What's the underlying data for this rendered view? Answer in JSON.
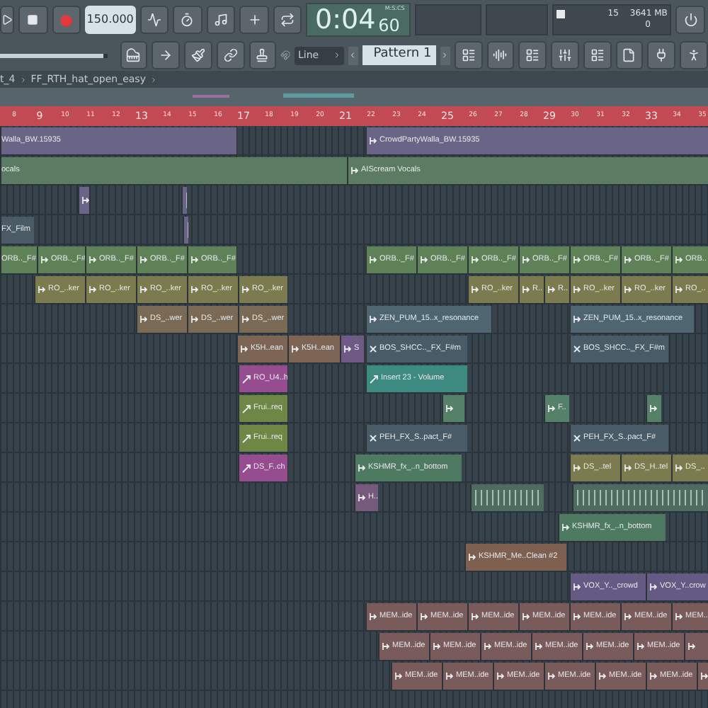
{
  "transport": {
    "tempo": "150.000",
    "time": "0:04",
    "time_cs": "60",
    "time_unit": "M:S:CS",
    "cpu": "15",
    "memory": "3641 MB",
    "polyphony": "0",
    "snap": "Line",
    "pattern": "Pattern 1",
    "volume": {
      "level": 0.97
    }
  },
  "breadcrumb": [
    "t_4",
    "FF_RTH_hat_open_easy"
  ],
  "ruler": [
    "8",
    "9",
    "10",
    "11",
    "12",
    "13",
    "14",
    "15",
    "16",
    "17",
    "18",
    "19",
    "20",
    "21",
    "22",
    "23",
    "24",
    "25",
    "26",
    "27",
    "28",
    "29",
    "30",
    "31",
    "32",
    "33",
    "34",
    "35"
  ],
  "tracks": [
    {
      "clips": [
        {
          "kind": "audio",
          "label": "Walla_BW.15935",
          "color": "#6a6486"
        },
        {
          "kind": "audio",
          "label": "CrowdPartyWalla_BW.15935",
          "color": "#6a6486"
        }
      ]
    },
    {
      "clips": [
        {
          "kind": "audio",
          "label": "ocals",
          "color": "#5b7c63"
        },
        {
          "kind": "audio",
          "label": "AIScream Vocals",
          "color": "#5b7c63"
        }
      ]
    },
    {
      "clips": [
        {
          "kind": "audio",
          "color": "#6a6486"
        },
        {
          "kind": "wave",
          "color": "#6a6486"
        }
      ]
    },
    {
      "clips": [
        {
          "kind": "audio",
          "label": "FX_Film",
          "color": "#4a5b66"
        },
        {
          "kind": "wave",
          "color": "#6a6486"
        }
      ]
    },
    {
      "clips": [
        {
          "kind": "audio",
          "label": "ORB.._F#",
          "color": "#5e8158"
        },
        {
          "kind": "audio",
          "label": "ORB.._F#",
          "color": "#5e8158"
        },
        {
          "kind": "audio",
          "label": "ORB.._F#",
          "color": "#5e8158"
        },
        {
          "kind": "audio",
          "label": "ORB.._F#",
          "color": "#5e8158"
        },
        {
          "kind": "audio",
          "label": "ORB.._F#",
          "color": "#5e8158"
        },
        {
          "kind": "audio",
          "label": "ORB.._F#",
          "color": "#5e8158"
        },
        {
          "kind": "audio",
          "label": "ORB.._F#",
          "color": "#5e8158"
        },
        {
          "kind": "audio",
          "label": "ORB.._F#",
          "color": "#5e8158"
        },
        {
          "kind": "audio",
          "label": "ORB.._F#",
          "color": "#5e8158"
        },
        {
          "kind": "audio",
          "label": "ORB.._F#",
          "color": "#5e8158"
        },
        {
          "kind": "audio",
          "label": "ORB.._F#",
          "color": "#5e8158"
        },
        {
          "kind": "audio",
          "label": "ORB..",
          "color": "#5e8158"
        }
      ]
    },
    {
      "clips": [
        {
          "kind": "audio",
          "label": "RO_..ker",
          "color": "#7c7b4f"
        },
        {
          "kind": "audio",
          "label": "RO_..ker",
          "color": "#7c7b4f"
        },
        {
          "kind": "audio",
          "label": "RO_..ker",
          "color": "#7c7b4f"
        },
        {
          "kind": "audio",
          "label": "RO_..ker",
          "color": "#7c7b4f"
        },
        {
          "kind": "audio",
          "label": "RO_..ker",
          "color": "#7c7b4f"
        },
        {
          "kind": "audio",
          "label": "RO_..ker",
          "color": "#7c7b4f"
        },
        {
          "kind": "audio",
          "label": "R..",
          "color": "#7c7b4f"
        },
        {
          "kind": "audio",
          "label": "R..",
          "color": "#7c7b4f"
        },
        {
          "kind": "audio",
          "label": "RO_..ker",
          "color": "#7c7b4f"
        },
        {
          "kind": "audio",
          "label": "RO_..ker",
          "color": "#7c7b4f"
        },
        {
          "kind": "audio",
          "label": "RO_..",
          "color": "#7c7b4f"
        }
      ]
    },
    {
      "clips": [
        {
          "kind": "audio",
          "label": "DS_..wer",
          "color": "#7a6954"
        },
        {
          "kind": "audio",
          "label": "DS_..wer",
          "color": "#7a6954"
        },
        {
          "kind": "audio",
          "label": "DS_..wer",
          "color": "#7a6954"
        },
        {
          "kind": "audio",
          "label": "ZEN_PUM_15..x_resonance",
          "color": "#4f6670"
        },
        {
          "kind": "audio",
          "label": "ZEN_PUM_15..x_resonance",
          "color": "#4f6670"
        }
      ]
    },
    {
      "clips": [
        {
          "kind": "audio",
          "label": "K5H..ean",
          "color": "#7d6556"
        },
        {
          "kind": "audio",
          "label": "K5H..ean",
          "color": "#7d6556"
        },
        {
          "kind": "audio",
          "label": "S",
          "color": "#6f5a85"
        },
        {
          "kind": "pattern",
          "label": "BOS_SHCC.._FX_F#m",
          "color": "#485b66"
        },
        {
          "kind": "pattern",
          "label": "BOS_SHCC.._FX_F#m",
          "color": "#485b66"
        }
      ]
    },
    {
      "clips": [
        {
          "kind": "automation",
          "label": "RO_U4..h",
          "color": "#954d8f"
        },
        {
          "kind": "automation",
          "label": "Insert 23 - Volume",
          "color": "#3d8a80"
        }
      ]
    },
    {
      "clips": [
        {
          "kind": "automation",
          "label": "Frui..req",
          "color": "#6e8646"
        },
        {
          "kind": "audio",
          "color": "#55806a"
        },
        {
          "kind": "audio",
          "label": "F..",
          "color": "#55806a"
        },
        {
          "kind": "audio",
          "color": "#55806a"
        }
      ]
    },
    {
      "clips": [
        {
          "kind": "automation",
          "label": "Frui..req",
          "color": "#6e8646"
        },
        {
          "kind": "pattern",
          "label": "PEH_FX_S..pact_F#",
          "color": "#485b66"
        },
        {
          "kind": "pattern",
          "label": "PEH_FX_S..pact_F#",
          "color": "#485b66"
        }
      ]
    },
    {
      "clips": [
        {
          "kind": "automation",
          "label": "DS_F..ch",
          "color": "#954d8f"
        },
        {
          "kind": "audio",
          "label": "KSHMR_fx_..n_bottom",
          "color": "#4f7a62"
        },
        {
          "kind": "audio",
          "label": "DS_..tel",
          "color": "#7c7b4f"
        },
        {
          "kind": "audio",
          "label": "DS_H..tel",
          "color": "#7c7b4f"
        },
        {
          "kind": "audio",
          "label": "DS_..",
          "color": "#7c7b4f"
        }
      ]
    },
    {
      "clips": [
        {
          "kind": "audio",
          "label": "H..",
          "color": "#765a7c"
        },
        {
          "kind": "wave",
          "color": "#4f6a60"
        },
        {
          "kind": "wave",
          "color": "#4f6a60"
        }
      ]
    },
    {
      "clips": [
        {
          "kind": "audio",
          "label": "KSHMR_fx_..n_bottom",
          "color": "#4f7a62"
        }
      ]
    },
    {
      "clips": [
        {
          "kind": "audio",
          "label": "KSHMR_Me..Clean #2",
          "color": "#7d6050"
        }
      ]
    },
    {
      "clips": [
        {
          "kind": "audio",
          "label": "VOX_Y.._crowd",
          "color": "#645a84"
        },
        {
          "kind": "audio",
          "label": "VOX_Y..crow",
          "color": "#645a84"
        }
      ]
    },
    {
      "clips": [
        {
          "kind": "audio",
          "label": "MEM..ide",
          "color": "#795b5b"
        },
        {
          "kind": "audio",
          "label": "MEM..ide",
          "color": "#795b5b"
        },
        {
          "kind": "audio",
          "label": "MEM..ide",
          "color": "#795b5b"
        },
        {
          "kind": "audio",
          "label": "MEM..ide",
          "color": "#795b5b"
        },
        {
          "kind": "audio",
          "label": "MEM..ide",
          "color": "#795b5b"
        },
        {
          "kind": "audio",
          "label": "MEM..ide",
          "color": "#795b5b"
        },
        {
          "kind": "audio",
          "label": "MEM..",
          "color": "#795b5b"
        }
      ]
    },
    {
      "clips": [
        {
          "kind": "audio",
          "label": "MEM..ide",
          "color": "#795b5b"
        },
        {
          "kind": "audio",
          "label": "MEM..ide",
          "color": "#795b5b"
        },
        {
          "kind": "audio",
          "label": "MEM..ide",
          "color": "#795b5b"
        },
        {
          "kind": "audio",
          "label": "MEM..ide",
          "color": "#795b5b"
        },
        {
          "kind": "audio",
          "label": "MEM..ide",
          "color": "#795b5b"
        },
        {
          "kind": "audio",
          "label": "MEM..ide",
          "color": "#795b5b"
        },
        {
          "kind": "audio",
          "color": "#795b5b"
        }
      ]
    },
    {
      "clips": [
        {
          "kind": "audio",
          "label": "MEM..ide",
          "color": "#795b5b"
        },
        {
          "kind": "audio",
          "label": "MEM..ide",
          "color": "#795b5b"
        },
        {
          "kind": "audio",
          "label": "MEM..ide",
          "color": "#795b5b"
        },
        {
          "kind": "audio",
          "label": "MEM..ide",
          "color": "#795b5b"
        },
        {
          "kind": "audio",
          "label": "MEM..ide",
          "color": "#795b5b"
        },
        {
          "kind": "audio",
          "label": "MEM..ide",
          "color": "#795b5b"
        },
        {
          "kind": "audio",
          "color": "#795b5b"
        }
      ]
    }
  ]
}
